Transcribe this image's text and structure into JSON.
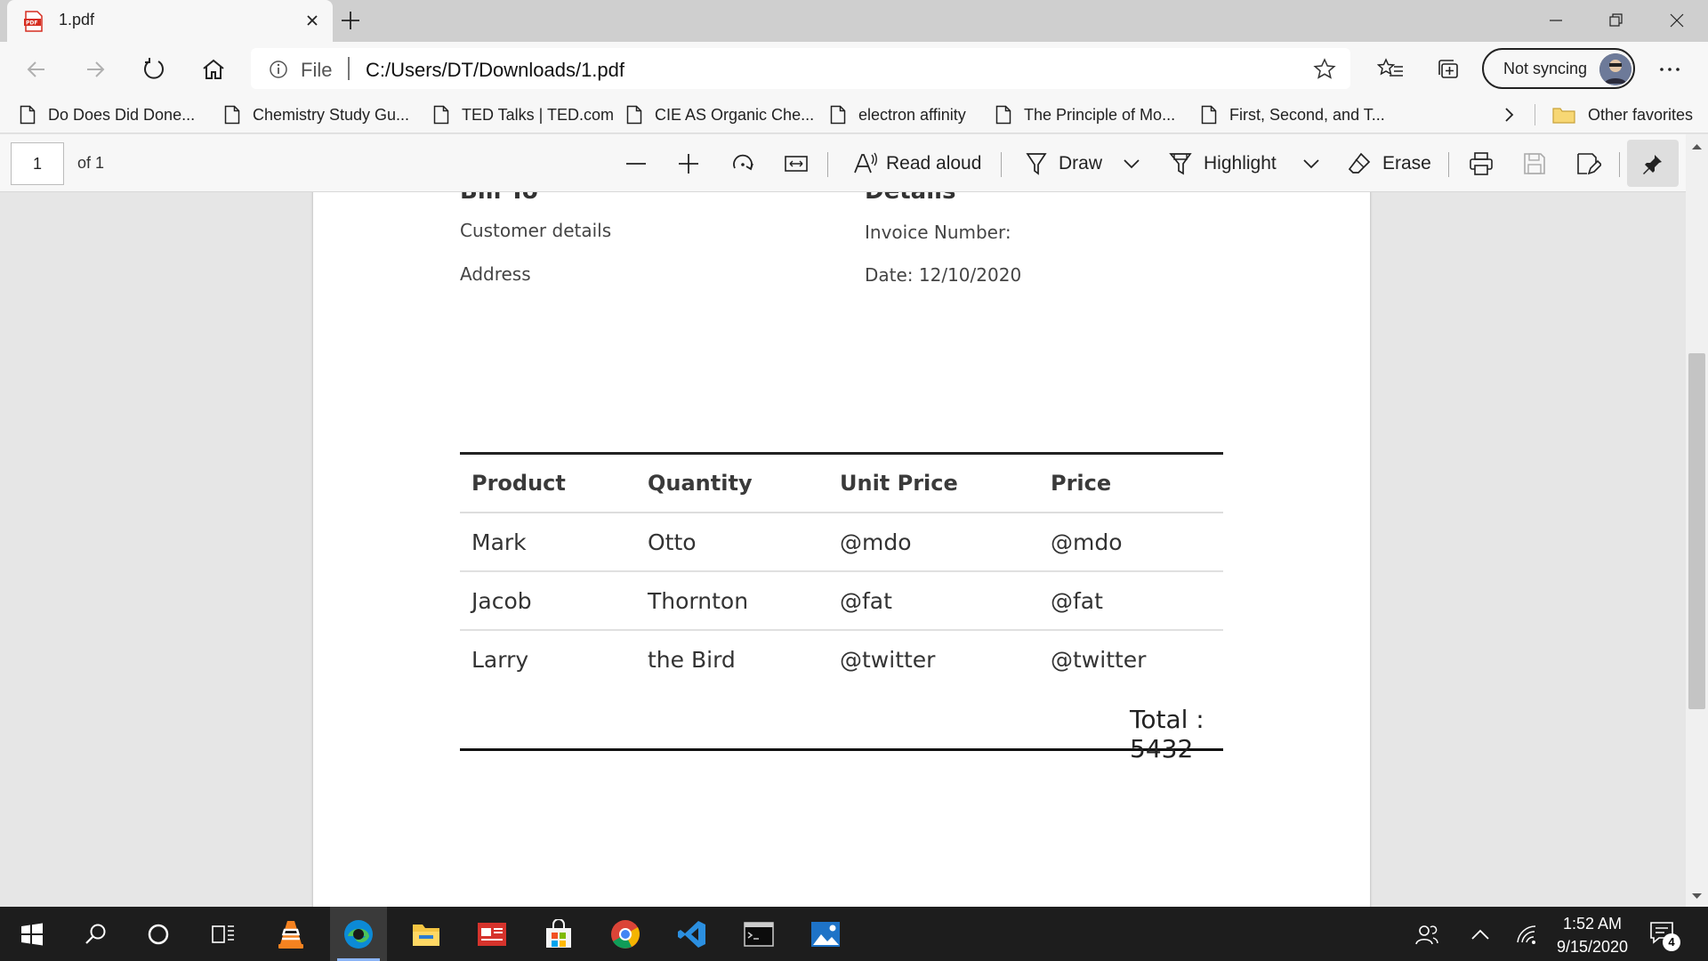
{
  "browser": {
    "tab_title": "1.pdf",
    "address_scheme": "File",
    "address_url": "C:/Users/DT/Downloads/1.pdf",
    "profile_label": "Not syncing"
  },
  "favorites": [
    {
      "label": "Do Does Did Done..."
    },
    {
      "label": "Chemistry Study Gu..."
    },
    {
      "label": "TED Talks | TED.com"
    },
    {
      "label": "CIE AS Organic Che..."
    },
    {
      "label": "electron affinity"
    },
    {
      "label": "The Principle of Mo..."
    },
    {
      "label": "First, Second, and T..."
    }
  ],
  "other_favorites": "Other favorites",
  "pdf_toolbar": {
    "page_value": "1",
    "page_of": "of 1",
    "read_aloud": "Read aloud",
    "draw": "Draw",
    "highlight": "Highlight",
    "erase": "Erase"
  },
  "document": {
    "bill_to_heading": "Bill To",
    "details_heading": "Details",
    "customer_details": "Customer details",
    "address": "Address",
    "invoice_number": "Invoice Number:",
    "date": "Date: 12/10/2020",
    "table": {
      "headers": [
        "Product",
        "Quantity",
        "Unit Price",
        "Price"
      ],
      "rows": [
        [
          "Mark",
          "Otto",
          "@mdo",
          "@mdo"
        ],
        [
          "Jacob",
          "Thornton",
          "@fat",
          "@fat"
        ],
        [
          "Larry",
          "the Bird",
          "@twitter",
          "@twitter"
        ]
      ]
    },
    "total": "Total : 5432"
  },
  "taskbar": {
    "time": "1:52 AM",
    "date": "9/15/2020",
    "notification_count": "4"
  },
  "colors": {
    "edge_blue": "#0078d7",
    "pdf_red": "#d62d20",
    "vscode_blue": "#2b8fe0"
  }
}
